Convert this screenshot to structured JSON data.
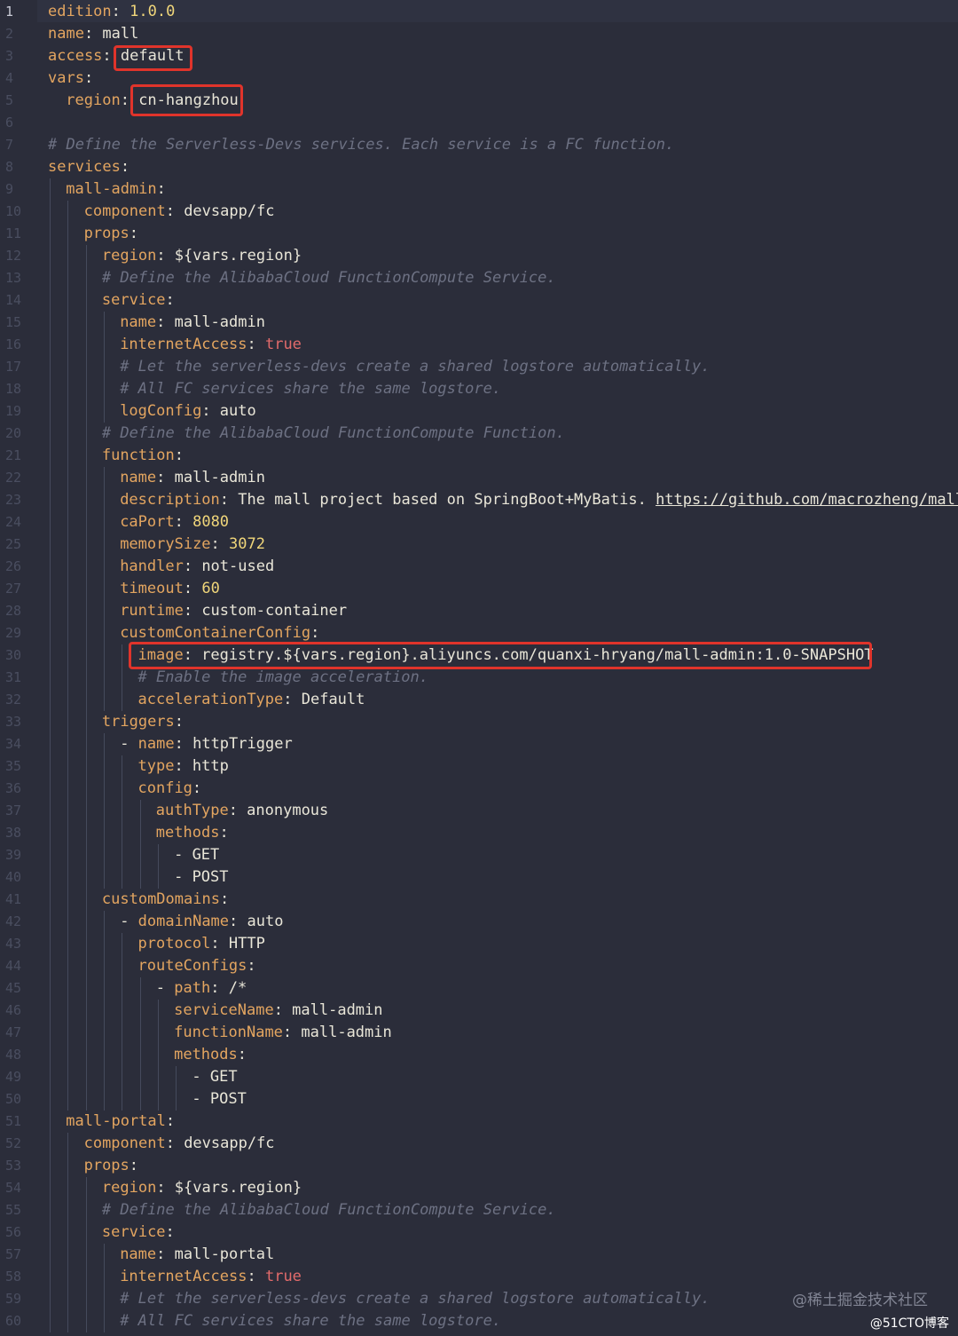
{
  "lines": [
    {
      "ln": "1",
      "i": 0,
      "t": [
        [
          "k",
          "edition"
        ],
        [
          "v",
          ": "
        ],
        [
          "n",
          "1.0.0"
        ]
      ]
    },
    {
      "ln": "2",
      "i": 0,
      "t": [
        [
          "k",
          "name"
        ],
        [
          "v",
          ": mall"
        ]
      ]
    },
    {
      "ln": "3",
      "i": 0,
      "t": [
        [
          "k",
          "access"
        ],
        [
          "v",
          ": default"
        ]
      ]
    },
    {
      "ln": "4",
      "i": 0,
      "t": [
        [
          "k",
          "vars"
        ],
        [
          "v",
          ":"
        ]
      ]
    },
    {
      "ln": "5",
      "i": 1,
      "t": [
        [
          "k",
          "region"
        ],
        [
          "v",
          ": cn-hangzhou"
        ]
      ]
    },
    {
      "ln": "6",
      "i": 0,
      "t": []
    },
    {
      "ln": "7",
      "i": 0,
      "t": [
        [
          "c",
          "# Define the Serverless-Devs services. Each service is a FC function."
        ]
      ]
    },
    {
      "ln": "8",
      "i": 0,
      "t": [
        [
          "k",
          "services"
        ],
        [
          "v",
          ":"
        ]
      ]
    },
    {
      "ln": "9",
      "i": 1,
      "t": [
        [
          "k",
          "mall-admin"
        ],
        [
          "v",
          ":"
        ]
      ]
    },
    {
      "ln": "10",
      "i": 2,
      "t": [
        [
          "k",
          "component"
        ],
        [
          "v",
          ": devsapp/fc"
        ]
      ]
    },
    {
      "ln": "11",
      "i": 2,
      "t": [
        [
          "k",
          "props"
        ],
        [
          "v",
          ":"
        ]
      ]
    },
    {
      "ln": "12",
      "i": 3,
      "t": [
        [
          "k",
          "region"
        ],
        [
          "v",
          ": ${vars.region}"
        ]
      ]
    },
    {
      "ln": "13",
      "i": 3,
      "t": [
        [
          "c",
          "# Define the AlibabaCloud FunctionCompute Service."
        ]
      ]
    },
    {
      "ln": "14",
      "i": 3,
      "t": [
        [
          "k",
          "service"
        ],
        [
          "v",
          ":"
        ]
      ]
    },
    {
      "ln": "15",
      "i": 4,
      "t": [
        [
          "k",
          "name"
        ],
        [
          "v",
          ": mall-admin"
        ]
      ]
    },
    {
      "ln": "16",
      "i": 4,
      "t": [
        [
          "k",
          "internetAccess"
        ],
        [
          "v",
          ": "
        ],
        [
          "b",
          "true"
        ]
      ]
    },
    {
      "ln": "17",
      "i": 4,
      "t": [
        [
          "c",
          "# Let the serverless-devs create a shared logstore automatically."
        ]
      ]
    },
    {
      "ln": "18",
      "i": 4,
      "t": [
        [
          "c",
          "# All FC services share the same logstore."
        ]
      ]
    },
    {
      "ln": "19",
      "i": 4,
      "t": [
        [
          "k",
          "logConfig"
        ],
        [
          "v",
          ": auto"
        ]
      ]
    },
    {
      "ln": "20",
      "i": 3,
      "t": [
        [
          "c",
          "# Define the AlibabaCloud FunctionCompute Function."
        ]
      ]
    },
    {
      "ln": "21",
      "i": 3,
      "t": [
        [
          "k",
          "function"
        ],
        [
          "v",
          ":"
        ]
      ]
    },
    {
      "ln": "22",
      "i": 4,
      "t": [
        [
          "k",
          "name"
        ],
        [
          "v",
          ": mall-admin"
        ]
      ]
    },
    {
      "ln": "23",
      "i": 4,
      "t": [
        [
          "k",
          "description"
        ],
        [
          "v",
          ": The mall project based on SpringBoot+MyBatis. "
        ],
        [
          "u",
          "https://github.com/macrozheng/mall"
        ]
      ]
    },
    {
      "ln": "24",
      "i": 4,
      "t": [
        [
          "k",
          "caPort"
        ],
        [
          "v",
          ": "
        ],
        [
          "n",
          "8080"
        ]
      ]
    },
    {
      "ln": "25",
      "i": 4,
      "t": [
        [
          "k",
          "memorySize"
        ],
        [
          "v",
          ": "
        ],
        [
          "n",
          "3072"
        ]
      ]
    },
    {
      "ln": "26",
      "i": 4,
      "t": [
        [
          "k",
          "handler"
        ],
        [
          "v",
          ": not-used"
        ]
      ]
    },
    {
      "ln": "27",
      "i": 4,
      "t": [
        [
          "k",
          "timeout"
        ],
        [
          "v",
          ": "
        ],
        [
          "n",
          "60"
        ]
      ]
    },
    {
      "ln": "28",
      "i": 4,
      "t": [
        [
          "k",
          "runtime"
        ],
        [
          "v",
          ": custom-container"
        ]
      ]
    },
    {
      "ln": "29",
      "i": 4,
      "t": [
        [
          "k",
          "customContainerConfig"
        ],
        [
          "v",
          ":"
        ]
      ]
    },
    {
      "ln": "30",
      "i": 5,
      "t": [
        [
          "k",
          "image"
        ],
        [
          "v",
          ": registry.${vars.region}.aliyuncs.com/quanxi-hryang/mall-admin:1.0-SNAPSHOT"
        ]
      ]
    },
    {
      "ln": "31",
      "i": 5,
      "t": [
        [
          "c",
          "# Enable the image acceleration."
        ]
      ]
    },
    {
      "ln": "32",
      "i": 5,
      "t": [
        [
          "k",
          "accelerationType"
        ],
        [
          "v",
          ": Default"
        ]
      ]
    },
    {
      "ln": "33",
      "i": 3,
      "t": [
        [
          "k",
          "triggers"
        ],
        [
          "v",
          ":"
        ]
      ]
    },
    {
      "ln": "34",
      "i": 4,
      "t": [
        [
          "v",
          "- "
        ],
        [
          "k",
          "name"
        ],
        [
          "v",
          ": httpTrigger"
        ]
      ]
    },
    {
      "ln": "35",
      "i": 5,
      "t": [
        [
          "k",
          "type"
        ],
        [
          "v",
          ": http"
        ]
      ]
    },
    {
      "ln": "36",
      "i": 5,
      "t": [
        [
          "k",
          "config"
        ],
        [
          "v",
          ":"
        ]
      ]
    },
    {
      "ln": "37",
      "i": 6,
      "t": [
        [
          "k",
          "authType"
        ],
        [
          "v",
          ": anonymous"
        ]
      ]
    },
    {
      "ln": "38",
      "i": 6,
      "t": [
        [
          "k",
          "methods"
        ],
        [
          "v",
          ":"
        ]
      ]
    },
    {
      "ln": "39",
      "i": 7,
      "t": [
        [
          "v",
          "- GET"
        ]
      ]
    },
    {
      "ln": "40",
      "i": 7,
      "t": [
        [
          "v",
          "- POST"
        ]
      ]
    },
    {
      "ln": "41",
      "i": 3,
      "t": [
        [
          "k",
          "customDomains"
        ],
        [
          "v",
          ":"
        ]
      ]
    },
    {
      "ln": "42",
      "i": 4,
      "t": [
        [
          "v",
          "- "
        ],
        [
          "k",
          "domainName"
        ],
        [
          "v",
          ": auto"
        ]
      ]
    },
    {
      "ln": "43",
      "i": 5,
      "t": [
        [
          "k",
          "protocol"
        ],
        [
          "v",
          ": HTTP"
        ]
      ]
    },
    {
      "ln": "44",
      "i": 5,
      "t": [
        [
          "k",
          "routeConfigs"
        ],
        [
          "v",
          ":"
        ]
      ]
    },
    {
      "ln": "45",
      "i": 6,
      "t": [
        [
          "v",
          "- "
        ],
        [
          "k",
          "path"
        ],
        [
          "v",
          ": /*"
        ]
      ]
    },
    {
      "ln": "46",
      "i": 7,
      "t": [
        [
          "k",
          "serviceName"
        ],
        [
          "v",
          ": mall-admin"
        ]
      ]
    },
    {
      "ln": "47",
      "i": 7,
      "t": [
        [
          "k",
          "functionName"
        ],
        [
          "v",
          ": mall-admin"
        ]
      ]
    },
    {
      "ln": "48",
      "i": 7,
      "t": [
        [
          "k",
          "methods"
        ],
        [
          "v",
          ":"
        ]
      ]
    },
    {
      "ln": "49",
      "i": 8,
      "t": [
        [
          "v",
          "- GET"
        ]
      ]
    },
    {
      "ln": "50",
      "i": 8,
      "t": [
        [
          "v",
          "- POST"
        ]
      ]
    },
    {
      "ln": "51",
      "i": 1,
      "t": [
        [
          "k",
          "mall-portal"
        ],
        [
          "v",
          ":"
        ]
      ]
    },
    {
      "ln": "52",
      "i": 2,
      "t": [
        [
          "k",
          "component"
        ],
        [
          "v",
          ": devsapp/fc"
        ]
      ]
    },
    {
      "ln": "53",
      "i": 2,
      "t": [
        [
          "k",
          "props"
        ],
        [
          "v",
          ":"
        ]
      ]
    },
    {
      "ln": "54",
      "i": 3,
      "t": [
        [
          "k",
          "region"
        ],
        [
          "v",
          ": ${vars.region}"
        ]
      ]
    },
    {
      "ln": "55",
      "i": 3,
      "t": [
        [
          "c",
          "# Define the AlibabaCloud FunctionCompute Service."
        ]
      ]
    },
    {
      "ln": "56",
      "i": 3,
      "t": [
        [
          "k",
          "service"
        ],
        [
          "v",
          ":"
        ]
      ]
    },
    {
      "ln": "57",
      "i": 4,
      "t": [
        [
          "k",
          "name"
        ],
        [
          "v",
          ": mall-portal"
        ]
      ]
    },
    {
      "ln": "58",
      "i": 4,
      "t": [
        [
          "k",
          "internetAccess"
        ],
        [
          "v",
          ": "
        ],
        [
          "b",
          "true"
        ]
      ]
    },
    {
      "ln": "59",
      "i": 4,
      "t": [
        [
          "c",
          "# Let the serverless-devs create a shared logstore automatically."
        ]
      ]
    },
    {
      "ln": "60",
      "i": 4,
      "t": [
        [
          "c",
          "# All FC services share the same logstore."
        ]
      ]
    }
  ],
  "watermark": {
    "site": "@稀土掘金技术社区",
    "blog": "@51CTO博客"
  },
  "colors": {
    "background": "#2b2d3a",
    "key": "#e3a560",
    "value": "#e9e6d8",
    "number": "#f0d67a",
    "boolean": "#e36b6b",
    "comment": "#6d7183",
    "highlight_box": "#e0342b"
  }
}
